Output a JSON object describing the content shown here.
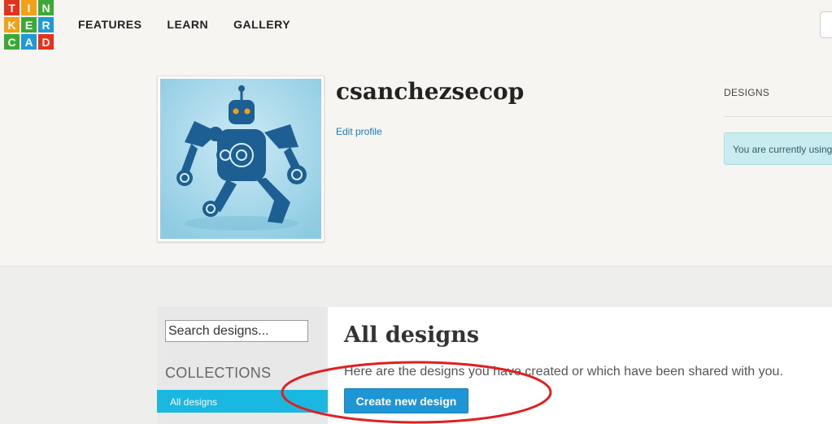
{
  "header": {
    "logo_letters": [
      "T",
      "I",
      "N",
      "K",
      "E",
      "R",
      "C",
      "A",
      "D"
    ],
    "logo_colors": [
      "#e5321c",
      "#f2a018",
      "#3aaa35",
      "#f2a018",
      "#3aaa35",
      "#1f9ad6",
      "#3aaa35",
      "#1f9ad6",
      "#e5321c"
    ],
    "nav": [
      {
        "label": "FEATURES"
      },
      {
        "label": "LEARN"
      },
      {
        "label": "GALLERY"
      }
    ]
  },
  "profile": {
    "username": "csanchezsecop",
    "edit_label": "Edit profile",
    "avatar_icon": "robot-avatar"
  },
  "right_panel": {
    "designs_label": "DESIGNS",
    "notice_text": "You are currently using"
  },
  "sidebar": {
    "search_placeholder": "Search designs...",
    "collections_label": "COLLECTIONS",
    "items": [
      {
        "label": "All designs"
      }
    ]
  },
  "main": {
    "title": "All designs",
    "description": "Here are the designs you have created or which have been shared with you.",
    "create_button": "Create new design"
  },
  "annotation": {
    "color": "#e02020",
    "shape": "ellipse"
  },
  "colors": {
    "accent": "#1ab8e0",
    "button": "#1e95d4",
    "link": "#1e7ab8",
    "notice_bg": "#c9ecf0",
    "avatar_bg": "#a9d8eb",
    "robot": "#1d5f92"
  }
}
